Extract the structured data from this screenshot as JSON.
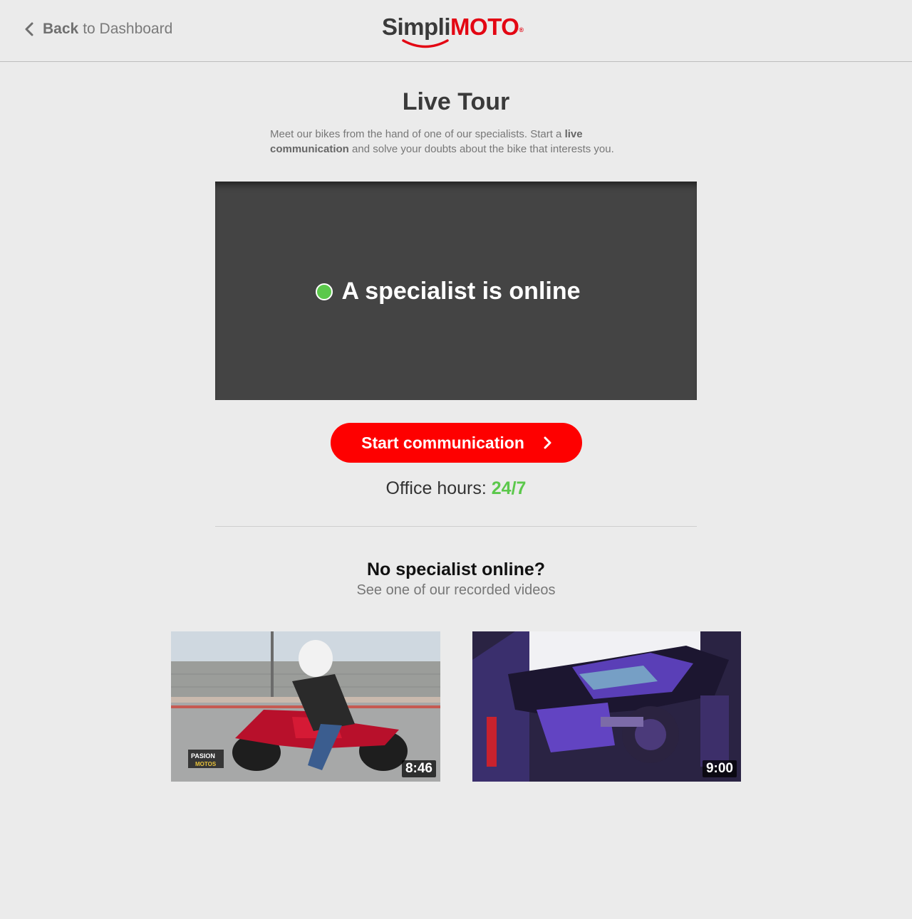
{
  "header": {
    "back_bold": "Back",
    "back_rest": "to Dashboard",
    "logo": {
      "part1": "Simpli",
      "part2": "MOTO",
      "reg": "®",
      "brand_red": "#e30613"
    }
  },
  "page": {
    "title": "Live Tour",
    "intro_part1": "Meet our bikes from the hand of one of our specialists. Start a ",
    "intro_bold": "live communication",
    "intro_part2": " and solve your doubts about the bike that interests you."
  },
  "live": {
    "status_text": "A specialist is online",
    "status_color": "#5bc84b",
    "button_label": "Start communication",
    "button_color": "#fe0000",
    "office_label": "Office hours:",
    "office_value": "24/7"
  },
  "recorded": {
    "heading": "No specialist online?",
    "subheading": "See one of our recorded videos",
    "videos": [
      {
        "duration": "8:46",
        "watermark": "PASION MOTOS",
        "icon": "video-thumbnail-red-bike"
      },
      {
        "duration": "9:00",
        "icon": "video-thumbnail-purple-bike"
      }
    ]
  }
}
